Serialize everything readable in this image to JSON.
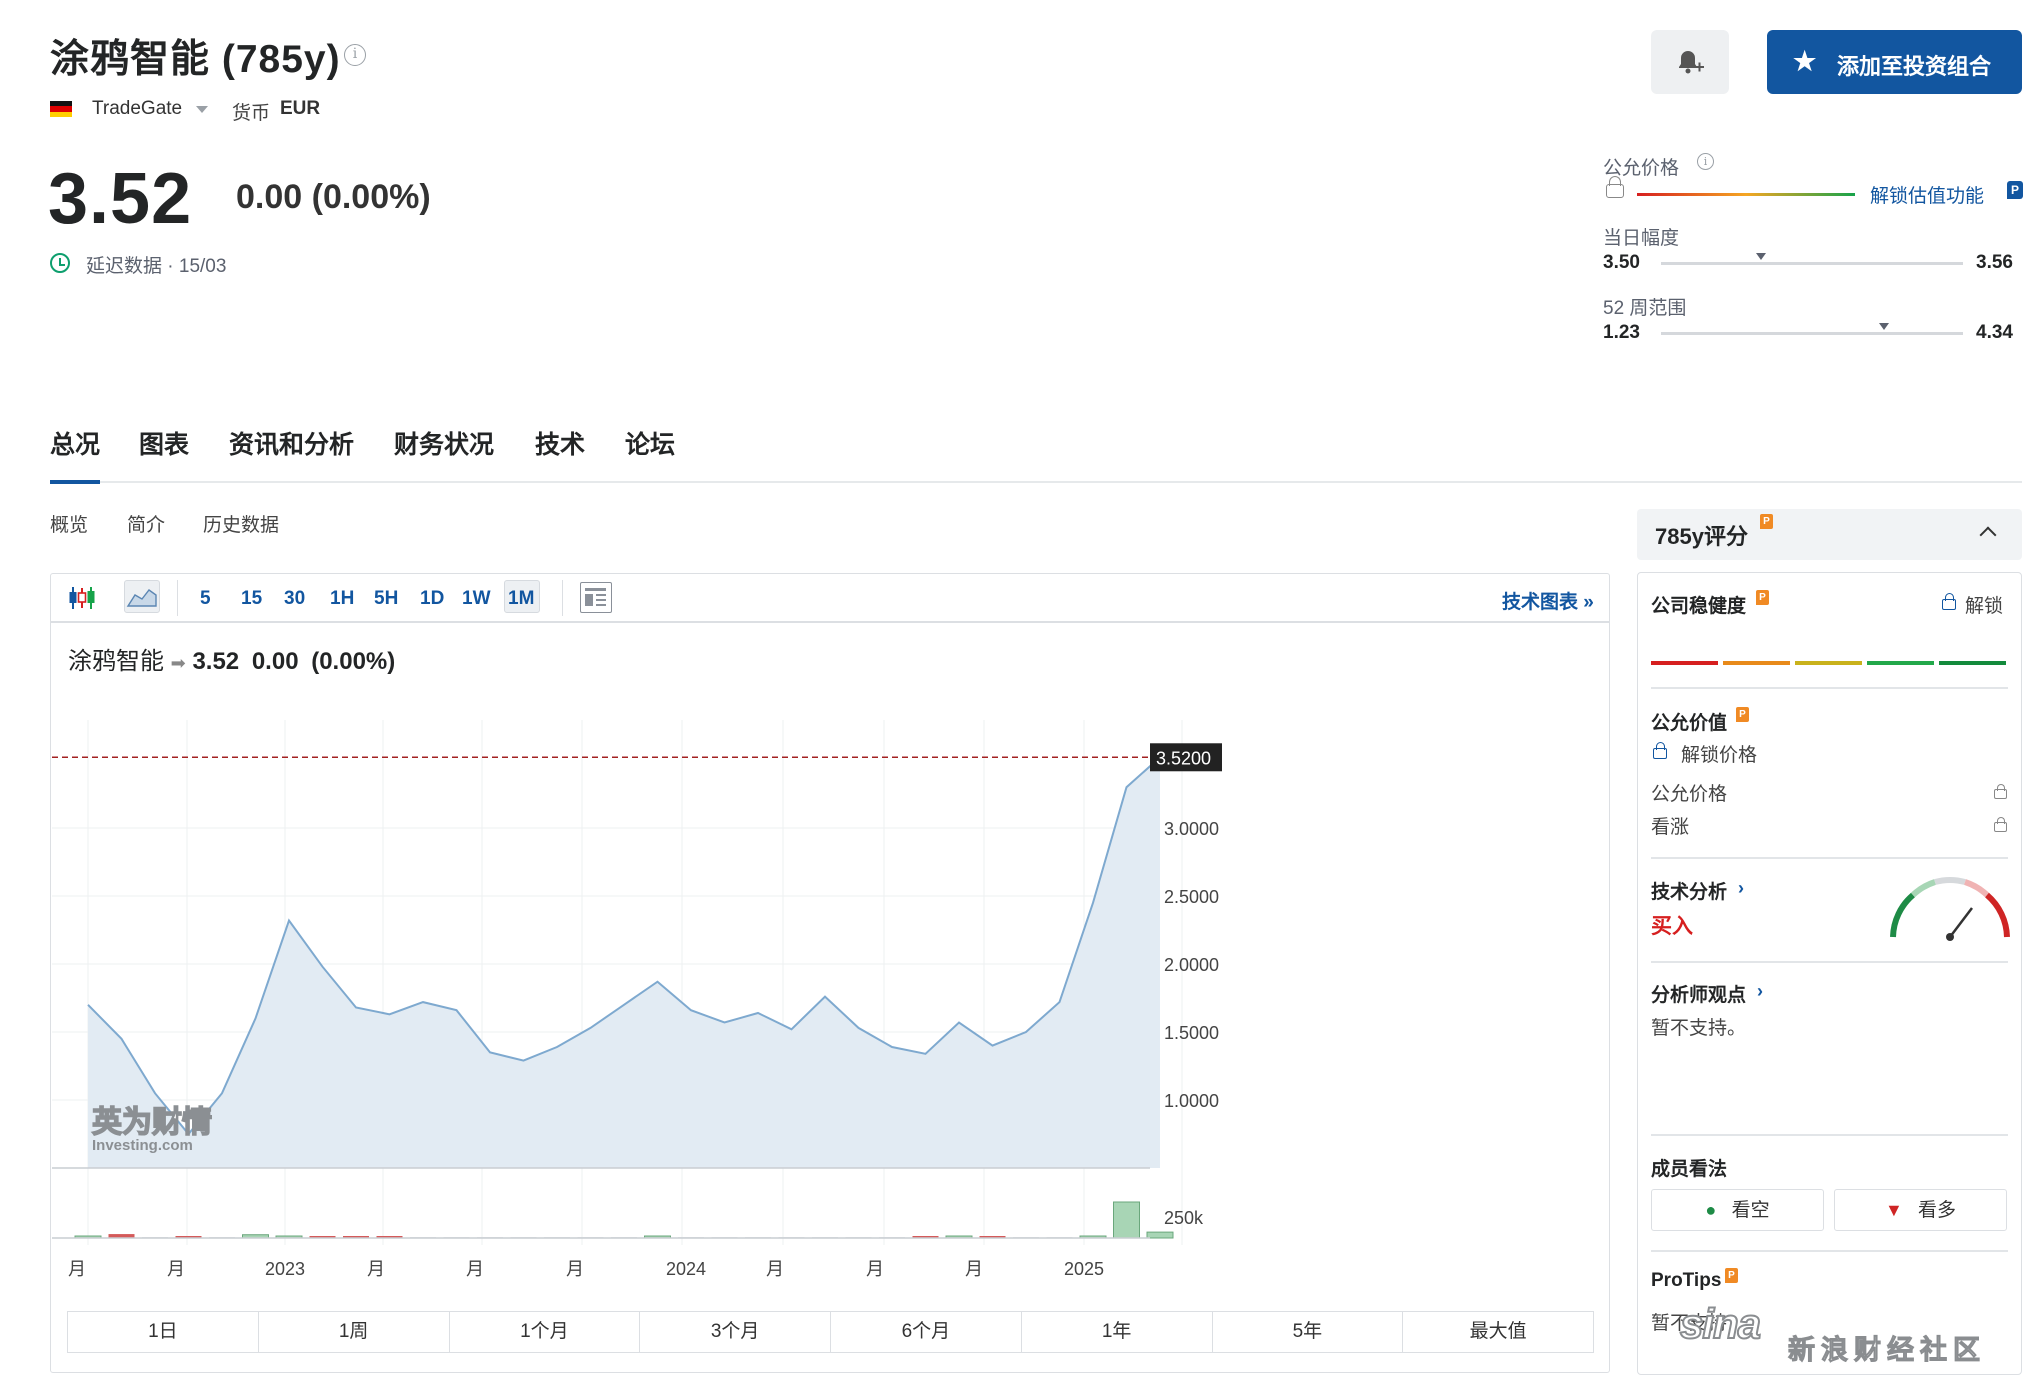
{
  "header": {
    "title": "涂鸦智能 (785y)",
    "exchange": "TradeGate",
    "currency_label": "货币",
    "currency": "EUR",
    "price": "3.52",
    "change": "0.00 (0.00%)",
    "delay_text": "延迟数据 · 15/03",
    "add_portfolio": "添加至投资组合"
  },
  "valuation": {
    "fair_price_label": "公允价格",
    "unlock_label": "解锁估值功能",
    "day_range_label": "当日幅度",
    "day_low": "3.50",
    "day_high": "3.56",
    "day_position": 0.33,
    "week52_label": "52 周范围",
    "week52_low": "1.23",
    "week52_high": "4.34",
    "week52_position": 0.74
  },
  "tabs": [
    "总况",
    "图表",
    "资讯和分析",
    "财务状况",
    "技术",
    "论坛"
  ],
  "subtabs": [
    "概览",
    "简介",
    "历史数据"
  ],
  "chart_toolbar": {
    "intervals": [
      "5",
      "15",
      "30",
      "1H",
      "5H",
      "1D",
      "1W",
      "1M"
    ],
    "tech_chart": "技术图表 »"
  },
  "chart_header": {
    "name": "涂鸦智能",
    "price": "3.52",
    "change": "0.00",
    "pct": "(0.00%)"
  },
  "chart_data": {
    "type": "area",
    "title": "",
    "x_labels": [
      "月",
      "月",
      "2023",
      "月",
      "月",
      "月",
      "2024",
      "月",
      "月",
      "月",
      "2025"
    ],
    "y_ticks": [
      "3.0000",
      "2.5000",
      "2.0000",
      "1.5000",
      "1.0000"
    ],
    "ylim": [
      0.5,
      3.5
    ],
    "last_price_label": "3.5200",
    "volume_tick": "250k",
    "values": [
      1.7,
      1.45,
      1.05,
      0.75,
      1.05,
      1.6,
      2.32,
      1.98,
      1.68,
      1.63,
      1.72,
      1.66,
      1.35,
      1.29,
      1.39,
      1.53,
      1.7,
      1.87,
      1.66,
      1.57,
      1.64,
      1.52,
      1.76,
      1.53,
      1.39,
      1.34,
      1.57,
      1.4,
      1.5,
      1.72,
      2.45,
      3.3,
      3.52
    ],
    "volume": [
      2,
      6,
      0,
      2,
      0,
      5,
      3,
      3,
      3,
      3,
      0,
      0,
      0,
      0,
      0,
      0,
      0,
      3,
      0,
      0,
      0,
      0,
      0,
      0,
      0,
      3,
      3,
      3,
      0,
      0,
      2,
      55,
      9
    ],
    "volume_up": [
      1,
      0,
      0,
      0,
      0,
      1,
      1,
      0,
      0,
      0,
      0,
      0,
      0,
      0,
      0,
      0,
      0,
      1,
      0,
      0,
      0,
      0,
      0,
      0,
      0,
      0,
      1,
      0,
      0,
      0,
      1,
      1,
      1
    ],
    "colors": {
      "line": "#7ea9cf",
      "fill": "#e2ebf3",
      "up": "#a8d5b5",
      "down": "#d45a5a",
      "last": "#a32020"
    }
  },
  "range_buttons": [
    "1日",
    "1周",
    "1个月",
    "3个月",
    "6个月",
    "1年",
    "5年",
    "最大值"
  ],
  "score_panel": {
    "title": "785y评分",
    "health_title": "公司稳健度",
    "health_unlock": "解锁",
    "fair_value_title": "公允价值",
    "fair_value_unlock": "解锁价格",
    "fair_price_row": "公允价格",
    "upside_row": "看涨",
    "tech_title": "技术分析",
    "tech_signal": "买入",
    "analyst_title": "分析师观点",
    "analyst_text": "暂不支持。",
    "member_title": "成员看法",
    "bear_label": "看空",
    "bull_label": "看多",
    "protips_title": "ProTips",
    "protips_text": "暂不支持",
    "health_colors": [
      "#d61f1f",
      "#e88a1a",
      "#c9b21c",
      "#22a84a",
      "#138a3c"
    ]
  },
  "watermark": {
    "investing": "英为财情",
    "investing_en": "Investing.com",
    "sina": "sina",
    "sina_cn": "新浪财经社区"
  }
}
